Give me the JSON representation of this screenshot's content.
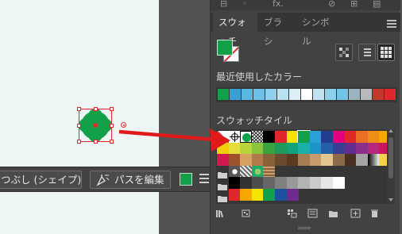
{
  "control_bar": {
    "shape_button_label": "つぶし (シェイプ)",
    "path_button_label": "パスを編集",
    "fill_color": "#12a148"
  },
  "panel": {
    "top_icon_fx": "fx.",
    "tabs": [
      {
        "label": "スウォッチ",
        "active": true
      },
      {
        "label": "ブラシ",
        "active": false
      },
      {
        "label": "シンボル",
        "active": false
      }
    ],
    "fill_color": "#12a148",
    "recent_colors_label": "最近使用したカラー",
    "recent_colors": [
      "#12a148",
      "#3a9fd4",
      "#5ab7e2",
      "#6dc0e6",
      "#8fd0ec",
      "#b8e2f2",
      "#dceff7",
      "#ffffff",
      "#bfe3f2",
      "#8ecfe9",
      "#6fc4e7",
      "#9bb4c0",
      "#b9b9b9",
      "#c0392b",
      "#e0282c"
    ],
    "swatch_tiles_label": "スウォッチタイル",
    "swatch_rows": [
      [
        "none",
        "registration",
        "#12a148-selected",
        "pattern",
        "#000000",
        "#e0282c",
        "#f5e400",
        "#12a148",
        "#2aa0d8",
        "#243d8f",
        "#e4007f",
        "#e0282c",
        "#ec6d24",
        "#f08c18",
        "#f6a800"
      ],
      [
        "#f0d000",
        "#e5dd3a",
        "#b8d43a",
        "#8bc43f",
        "#3aa33e",
        "#1f9a5a",
        "#14a27d",
        "#1ab0a9",
        "#1e94c9",
        "#2360a8",
        "#3a3f93",
        "#662d91",
        "#8b2f8d",
        "#b5287b",
        "#c8175d"
      ],
      [
        "#d11a4d",
        "#a0522d",
        "#d8a060",
        "#b07a4a",
        "#8a6239",
        "#6d4a2d",
        "#5a3b22",
        "#a67c52",
        "#c69c6d",
        "#e2c58f",
        "#8b6b4a",
        "#4a3020",
        "#a3a3a3",
        "grad",
        "#f5d24a"
      ]
    ],
    "pattern_row": [
      "p1",
      "p2",
      "p3",
      "p4"
    ],
    "gray_row": [
      "#000000",
      "#333333",
      "#4d4d4d",
      "#666666",
      "#808080",
      "#999999",
      "#b3b3b3",
      "#cccccc",
      "#e6e6e6",
      "#ffffff"
    ],
    "color_row": [
      "#e0282c",
      "#f5a800",
      "#f5e400",
      "#12a148",
      "#1f4fa0",
      "#6e2c8f"
    ]
  }
}
